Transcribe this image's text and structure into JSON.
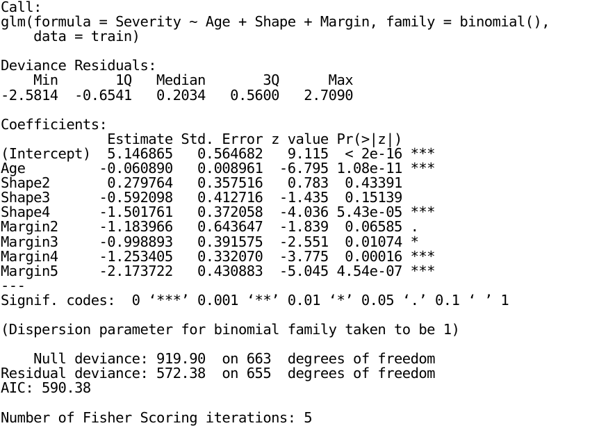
{
  "call_header": "Call:",
  "call_line1": "glm(formula = Severity ~ Age + Shape + Margin, family = binomial(),",
  "call_line2": "    data = train)",
  "deviance_residuals": {
    "title": "Deviance Residuals:",
    "header": "    Min       1Q   Median       3Q      Max",
    "values": "-2.5814  -0.6541   0.2034   0.5600   2.7090"
  },
  "coefficients": {
    "title": "Coefficients:",
    "header": "             Estimate Std. Error z value Pr(>|z|)    ",
    "rows": [
      "(Intercept)  5.146865   0.564682   9.115  < 2e-16 ***",
      "Age         -0.060890   0.008961  -6.795 1.08e-11 ***",
      "Shape2       0.279764   0.357516   0.783  0.43391    ",
      "Shape3      -0.592098   0.412716  -1.435  0.15139    ",
      "Shape4      -1.501761   0.372058  -4.036 5.43e-05 ***",
      "Margin2     -1.183966   0.643647  -1.839  0.06585 .  ",
      "Margin3     -0.998893   0.391575  -2.551  0.01074 *  ",
      "Margin4     -1.253405   0.332070  -3.775  0.00016 ***",
      "Margin5     -2.173722   0.430883  -5.045 4.54e-07 ***"
    ],
    "separator": "---",
    "signif_codes": "Signif. codes:  0 ‘***’ 0.001 ‘**’ 0.01 ‘*’ 0.05 ‘.’ 0.1 ‘ ’ 1"
  },
  "dispersion_note": "(Dispersion parameter for binomial family taken to be 1)",
  "null_deviance": "    Null deviance: 919.90  on 663  degrees of freedom",
  "residual_deviance": "Residual deviance: 572.38  on 655  degrees of freedom",
  "aic": "AIC: 590.38",
  "fisher_iterations": "Number of Fisher Scoring iterations: 5"
}
